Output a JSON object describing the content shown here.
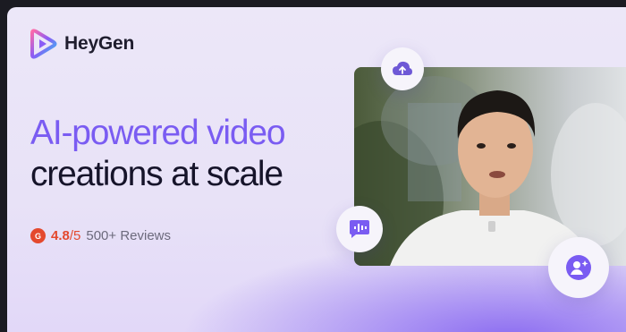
{
  "brand": {
    "name": "HeyGen"
  },
  "hero": {
    "headline_line1": "AI-powered video",
    "headline_line2": "creations at scale"
  },
  "rating": {
    "score": "4.8",
    "out_of": "/5",
    "reviews": "500+ Reviews"
  },
  "icons": {
    "upload": "cloud-upload-icon",
    "chat": "message-waveform-icon",
    "avatar": "user-sparkle-icon",
    "review_site": "g2-logo-icon"
  },
  "colors": {
    "accent": "#7a5cf2",
    "headline_dark": "#16142a",
    "rating": "#e4492e",
    "background": "#ece7f8"
  }
}
